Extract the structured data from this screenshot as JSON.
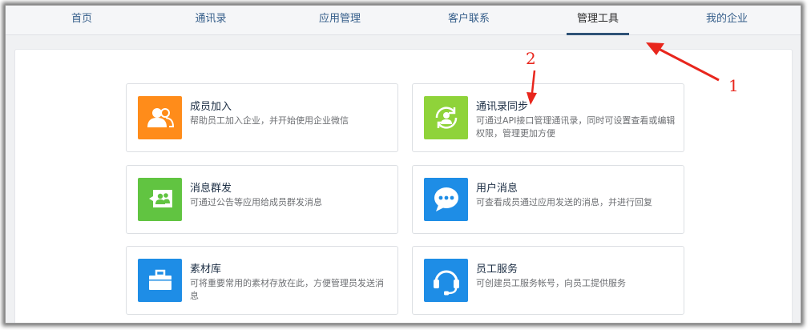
{
  "nav": {
    "items": [
      "首页",
      "通讯录",
      "应用管理",
      "客户联系",
      "管理工具",
      "我的企业"
    ],
    "active_index": 4
  },
  "colors": {
    "nav_text": "#355e8a",
    "orange": "#ff8c1a",
    "green": "#61c441",
    "lime": "#8fd33a",
    "blue": "#1e8de6",
    "annotation": "#e8261d"
  },
  "cards": [
    {
      "title": "成员加入",
      "desc": "帮助员工加入企业，并开始使用企业微信",
      "icon": "people-icon",
      "color": "#ff8c1a"
    },
    {
      "title": "通讯录同步",
      "desc": "可通过API接口管理通讯录，同时可设置查看或编辑权限，管理更加方便",
      "icon": "sync-user-icon",
      "color": "#8fd33a"
    },
    {
      "title": "消息群发",
      "desc": "可通过公告等应用给成员群发消息",
      "icon": "broadcast-message-icon",
      "color": "#61c441"
    },
    {
      "title": "用户消息",
      "desc": "可查看成员通过应用发送的消息，并进行回复",
      "icon": "chat-bubble-icon",
      "color": "#1e8de6"
    },
    {
      "title": "素材库",
      "desc": "可将重要常用的素材存放在此，方便管理员发送消息",
      "icon": "briefcase-icon",
      "color": "#1e8de6"
    },
    {
      "title": "员工服务",
      "desc": "可创建员工服务帐号，向员工提供服务",
      "icon": "headset-icon",
      "color": "#1e8de6"
    }
  ],
  "annotations": {
    "label_1": "1",
    "label_2": "2"
  }
}
